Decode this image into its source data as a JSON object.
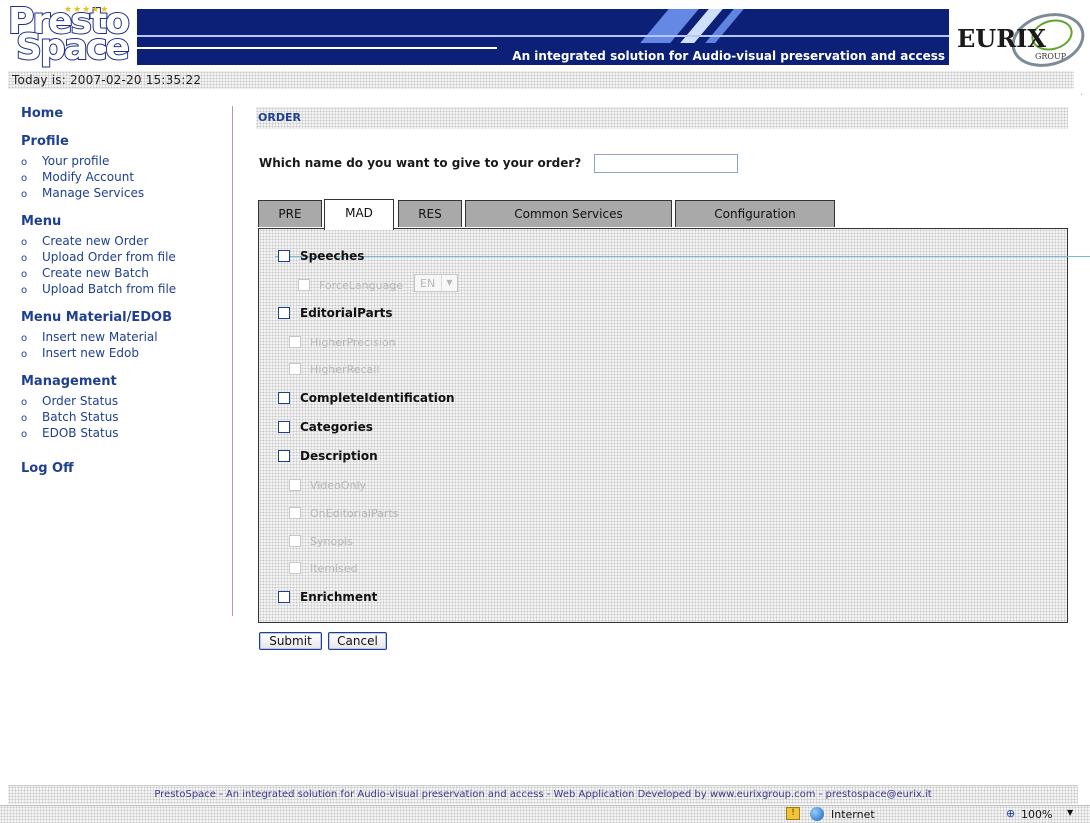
{
  "header": {
    "logo_line1": "Presto",
    "logo_line2": "Space",
    "tagline": "An integrated solution for Audio-visual preservation and access",
    "partner_logo": "EURIX",
    "partner_sub": "GROUP"
  },
  "date_text": "Today is: 2007-02-20 15:35:22",
  "sidebar": {
    "home": "Home",
    "sections": [
      {
        "title": "Profile",
        "items": [
          "Your profile",
          "Modify Account",
          "Manage Services"
        ]
      },
      {
        "title": "Menu",
        "items": [
          "Create new Order",
          "Upload Order from file",
          "Create new Batch",
          "Upload Batch from file"
        ]
      },
      {
        "title": "Menu Material/EDOB",
        "items": [
          "Insert new Material",
          "Insert new Edob"
        ]
      },
      {
        "title": "Management",
        "items": [
          "Order Status",
          "Batch Status",
          "EDOB Status"
        ]
      }
    ],
    "logoff": "Log Off",
    "bullet": "o"
  },
  "main": {
    "section_title": "ORDER",
    "order_name_label": "Which name do you want to give to your order?",
    "order_name_value": "",
    "tabs": [
      {
        "label": "PRE",
        "active": false
      },
      {
        "label": "MAD",
        "active": true
      },
      {
        "label": "RES",
        "active": false
      },
      {
        "label": "Common Services",
        "active": false
      },
      {
        "label": "Configuration",
        "active": false
      }
    ],
    "options": {
      "speeches": "Speeches",
      "force_language": "ForceLanguage",
      "language_value": "EN",
      "editorial_parts": "EditorialParts",
      "higher_precision": "HigherPrecision",
      "higher_recall": "HigherRecall",
      "complete_identification": "CompleteIdentification",
      "categories": "Categories",
      "description": "Description",
      "video_only": "VideoOnly",
      "on_editorial_parts": "OnEditorialParts",
      "synopis": "Synopis",
      "itemised": "Itemised",
      "enrichment": "Enrichment"
    },
    "submit": "Submit",
    "cancel": "Cancel"
  },
  "footer": "PrestoSpace - An integrated solution for Audio-visual preservation and access - Web Application Developed by www.eurixgroup.com - prestospace@eurix.it",
  "statusbar": {
    "zone": "Internet",
    "zoom": "100%"
  },
  "colors": {
    "banner": "#0d2077",
    "link": "#1f3f91",
    "tab_inactive": "#a9a9a9"
  }
}
